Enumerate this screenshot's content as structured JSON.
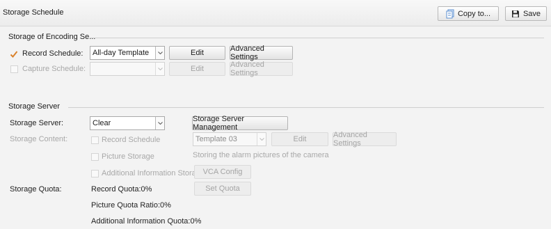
{
  "header": {
    "title": "Storage Schedule",
    "copy_label": "Copy to...",
    "save_label": "Save"
  },
  "encoding": {
    "section_title": "Storage of Encoding Se...",
    "record_schedule_label": "Record Schedule:",
    "record_schedule_checked": true,
    "record_template": "All-day Template",
    "capture_schedule_label": "Capture Schedule:",
    "capture_schedule_checked": false,
    "capture_template": "",
    "edit_label": "Edit",
    "advanced_label": "Advanced Settings"
  },
  "server": {
    "section_title": "Storage Server",
    "server_label": "Storage Server:",
    "server_value": "Clear",
    "management_label": "Storage Server Management",
    "content_label": "Storage Content:",
    "record_schedule_label": "Record Schedule",
    "template_value": "Template 03",
    "edit_label": "Edit",
    "advanced_label": "Advanced Settings",
    "picture_storage_label": "Picture Storage",
    "picture_storage_note": "Storing the alarm pictures of the camera",
    "additional_info_label": "Additional Information Storage",
    "vca_config_label": "VCA Config",
    "quota_label": "Storage Quota:",
    "record_quota": "Record Quota:0%",
    "set_quota_label": "Set Quota",
    "picture_quota": "Picture Quota Ratio:0%",
    "additional_quota": "Additional Information Quota:0%"
  },
  "colors": {
    "checkmark": "#d9822b",
    "save_icon": "#2b2b2b",
    "copy_icon": "#5b8fd1"
  },
  "icons": {
    "copy": "copy-icon",
    "save": "floppy-disk-icon",
    "dropdown": "chevron-down-icon",
    "check": "checkmark-icon"
  }
}
